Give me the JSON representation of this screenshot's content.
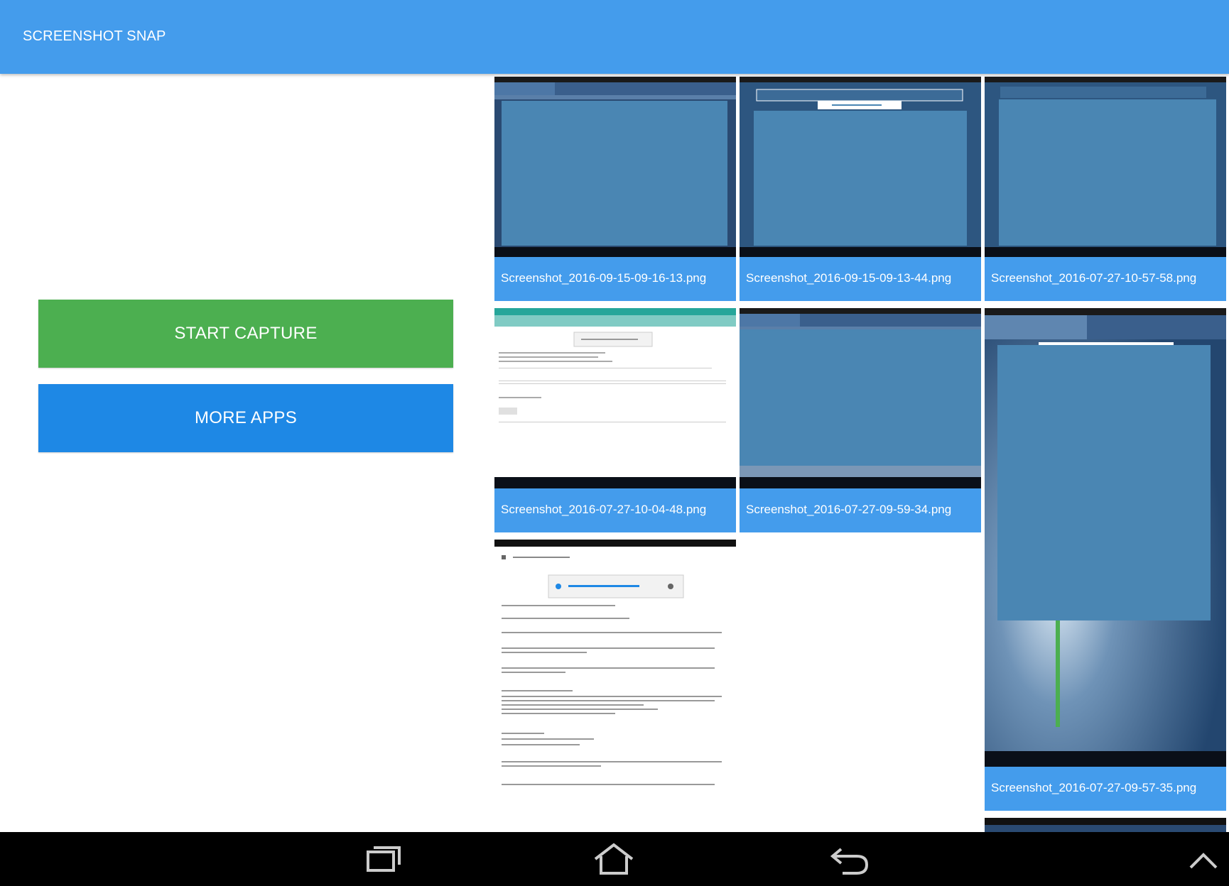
{
  "app": {
    "title": "SCREENSHOT SNAP"
  },
  "actions": {
    "start_capture": "START CAPTURE",
    "more_apps": "MORE APPS"
  },
  "colors": {
    "appbar": "#449cec",
    "start_button": "#4caf50",
    "more_button": "#1e88e5",
    "caption": "#449cec",
    "navbar": "#000000"
  },
  "screenshots": [
    {
      "filename": "Screenshot_2016-09-15-09-16-13.png"
    },
    {
      "filename": "Screenshot_2016-09-15-09-13-44.png"
    },
    {
      "filename": "Screenshot_2016-07-27-10-57-58.png"
    },
    {
      "filename": "Screenshot_2016-07-27-10-04-48.png"
    },
    {
      "filename": "Screenshot_2016-07-27-09-59-34.png"
    },
    {
      "filename": "Screenshot_2016-07-27-09-57-35.png"
    }
  ],
  "navbar": {
    "icons": [
      "recent-apps-icon",
      "home-icon",
      "back-icon",
      "chevron-up-icon"
    ]
  }
}
